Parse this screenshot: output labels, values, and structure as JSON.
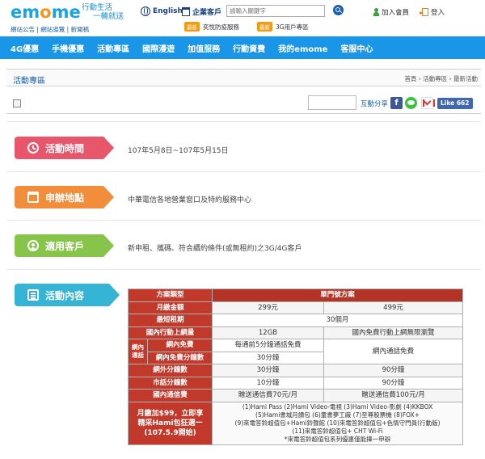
{
  "header": {
    "logo_main": "emome",
    "tagline_1": "行動生活",
    "tagline_2": "一機就送",
    "top_links": "網站公告 | 網站導覽 | 新聞稿",
    "lang_label": "English",
    "business_label": "企業客戶",
    "search_placeholder": "請輸入關鍵字",
    "join_label": "加入會員",
    "login_label": "登入",
    "promo_badge": "最新",
    "promo_1": "奕悅防疫服務",
    "promo_2": "3G用戶專區"
  },
  "nav": {
    "items": [
      "4G優惠",
      "手機優惠",
      "活動專區",
      "國際漫遊",
      "加值服務",
      "行動資費",
      "我的emome",
      "客服中心"
    ]
  },
  "page": {
    "title": "活動專區",
    "breadcrumb": "首頁 › 活動專區 › 最新活動"
  },
  "share": {
    "label": "互動分享",
    "like_label": "Like 662",
    "fb_glyph": "f"
  },
  "sections": {
    "time": {
      "title": "活動時間",
      "text": "107年5月8日~107年5月15日"
    },
    "place": {
      "title": "申辦地點",
      "text": "中華電信各地營業窗口及特約服務中心"
    },
    "customer": {
      "title": "適用客戶",
      "text": "新申租、攜碼、符合續約條件(或無租約)之3G/4G客戶"
    },
    "content": {
      "title": "活動內容"
    }
  },
  "plan_table": {
    "header_label": "方案類型",
    "header_value": "單門號方案",
    "rows": {
      "monthly_fee": {
        "label": "月繳金額",
        "a": "299元",
        "b": "499元"
      },
      "min_term": {
        "label": "最短租期",
        "v": "30個月"
      },
      "data": {
        "label": "國內行動上網量",
        "a": "12GB",
        "b": "國內免費行動上網無限瀏覽"
      },
      "net_group": "網內通話",
      "net_free": {
        "label": "網內免費",
        "a": "每通前5分鐘通話免費",
        "b": "網內通話免費"
      },
      "net_free_min": {
        "label": "網內免費分鐘數",
        "a": "30分鐘"
      },
      "offnet": {
        "label": "網外分鐘數",
        "a": "30分鐘",
        "b": "90分鐘"
      },
      "landline": {
        "label": "市話分鐘數",
        "a": "10分鐘",
        "b": "90分鐘"
      },
      "domestic_sms": {
        "label": "國內通信費",
        "a": "贈送通信費70元/月",
        "b": "贈送通信費100元/月"
      },
      "bundle": {
        "label_1": "月繳加$99，立即享",
        "label_2": "精采Hami包狂選一",
        "label_3": "(107.5.9開始)",
        "line_1": "(1)Hami Pass (2)Hami Video-電視 (3)Hami Video-影劇 (4)KKBOX",
        "line_2": "(5)Hami書城月讀包 (6)童書夢工廠 (7)至尊股票機 (8)FOX+",
        "line_3": "(9)來電答鈴超值包+Hami鈴聲館 (10)來電答鈴超值包+色情守門員(行動版)",
        "line_4": "(11)來電答鈴超值包+ CHT Wi-Fi",
        "line_5": "*來電答鈴超值包系列優惠僅能擇一申辦"
      }
    }
  },
  "colors": {
    "nav_blue": "#1a96e8",
    "time_red": "#e8566b",
    "place_orange": "#f28d3c",
    "customer_green": "#86c54a",
    "content_cyan": "#35b4d6",
    "table_red": "#c0392b"
  }
}
